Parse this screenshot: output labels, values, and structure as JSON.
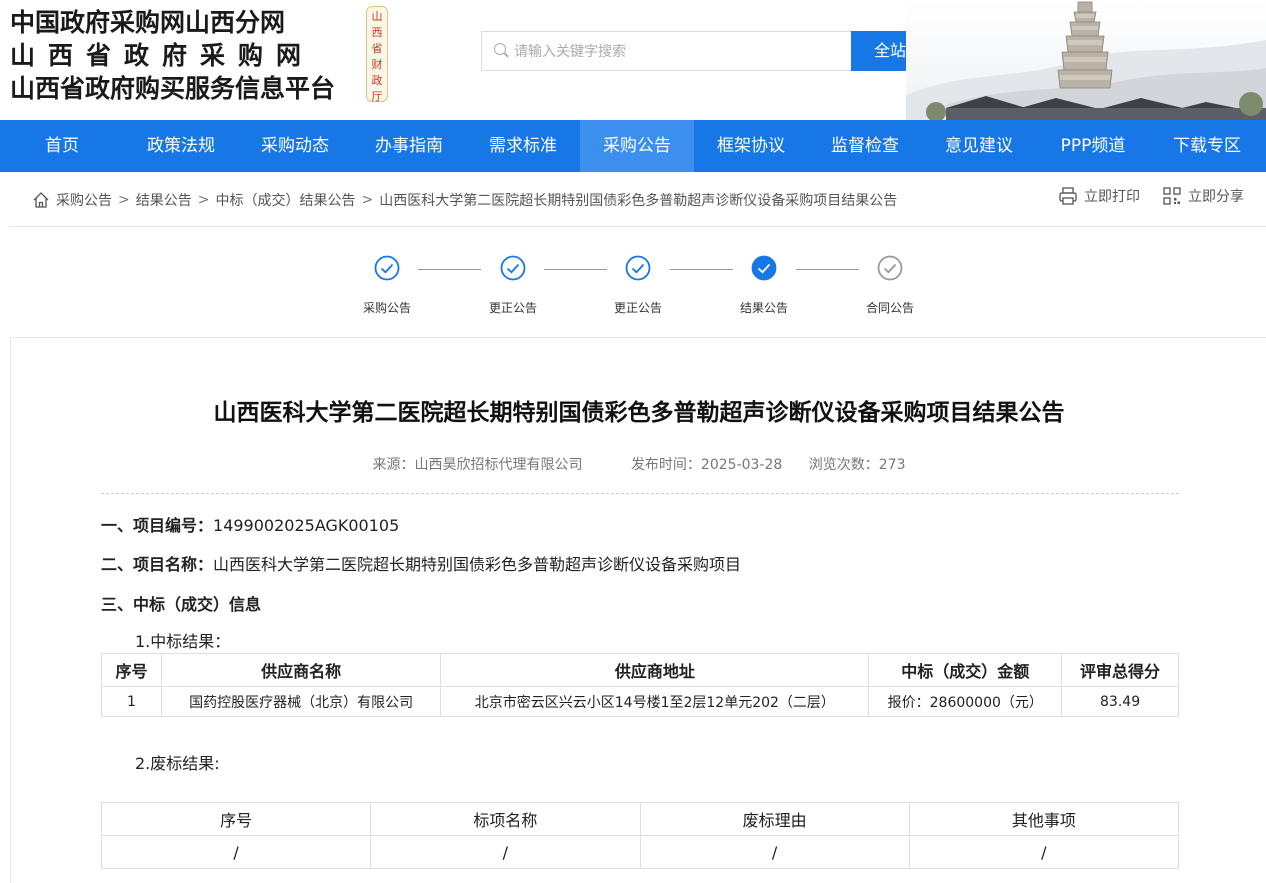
{
  "logo": {
    "line1": "中国政府采购网山西分网",
    "line2": "山西省政府采购网",
    "line3": "山西省政府购买服务信息平台",
    "seal": [
      "山",
      "西",
      "省",
      "财",
      "政",
      "厅"
    ]
  },
  "search": {
    "placeholder": "请输入关键字搜索",
    "button": "全站搜索"
  },
  "nav": {
    "items": [
      "首页",
      "政策法规",
      "采购动态",
      "办事指南",
      "需求标准",
      "采购公告",
      "框架协议",
      "监督检查",
      "意见建议",
      "PPP频道",
      "下载专区"
    ],
    "active_index": 5
  },
  "breadcrumb": {
    "items": [
      "采购公告",
      "结果公告",
      "中标（成交）结果公告",
      "山西医科大学第二医院超长期特别国债彩色多普勒超声诊断仪设备采购项目结果公告"
    ],
    "separator": ">"
  },
  "tools": {
    "print": "立即打印",
    "share": "立即分享"
  },
  "progress": {
    "steps": [
      {
        "label": "采购公告",
        "state": "done"
      },
      {
        "label": "更正公告",
        "state": "done"
      },
      {
        "label": "更正公告",
        "state": "done"
      },
      {
        "label": "结果公告",
        "state": "current"
      },
      {
        "label": "合同公告",
        "state": "pending"
      }
    ],
    "colors": {
      "done": "#1777e6",
      "current": "#1777e6",
      "pending": "#999999"
    }
  },
  "article": {
    "title": "山西医科大学第二医院超长期特别国债彩色多普勒超声诊断仪设备采购项目结果公告",
    "source": "来源：山西昊欣招标代理有限公司",
    "publish_time": "发布时间：2025-03-28",
    "views": "浏览次数：273",
    "section1_label": "一、项目编号：",
    "section1_value": "1499002025AGK00105",
    "section2_label": "二、项目名称：",
    "section2_value": "山西医科大学第二医院超长期特别国债彩色多普勒超声诊断仪设备采购项目",
    "section3_label": "三、中标（成交）信息",
    "sub1": "1.中标结果：",
    "sub2": "2.废标结果:",
    "win_table": {
      "headers": [
        "序号",
        "供应商名称",
        "供应商地址",
        "中标（成交）金额",
        "评审总得分"
      ],
      "rows": [
        [
          "1",
          "国药控股医疗器械（北京）有限公司",
          "北京市密云区兴云小区14号楼1至2层12单元202（二层）",
          "报价：28600000（元）",
          "83.49"
        ]
      ]
    },
    "fail_table": {
      "headers": [
        "序号",
        "标项名称",
        "废标理由",
        "其他事项"
      ],
      "rows": [
        [
          "/",
          "/",
          "/",
          "/"
        ]
      ]
    }
  },
  "colors": {
    "brand_blue": "#1777e6",
    "nav_active": "#3b8fef"
  }
}
